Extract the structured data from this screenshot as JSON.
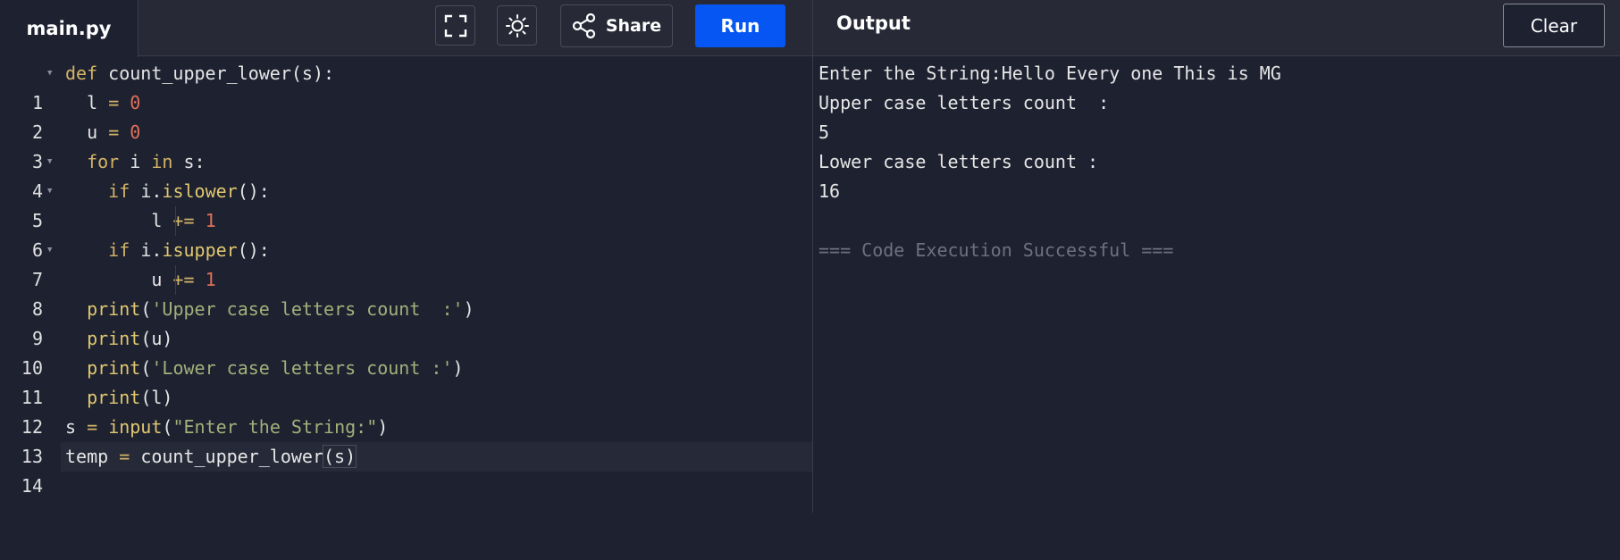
{
  "header": {
    "file_tab": "main.py",
    "share_label": "Share",
    "run_label": "Run",
    "output_title": "Output",
    "clear_label": "Clear"
  },
  "editor": {
    "lines": [
      {
        "num": "1"
      },
      {
        "num": "2"
      },
      {
        "num": "3"
      },
      {
        "num": "4"
      },
      {
        "num": "5"
      },
      {
        "num": "6"
      },
      {
        "num": "7"
      },
      {
        "num": "8"
      },
      {
        "num": "9"
      },
      {
        "num": "10"
      },
      {
        "num": "11"
      },
      {
        "num": "12"
      },
      {
        "num": "13"
      },
      {
        "num": "14"
      }
    ],
    "tokens": {
      "def": "def",
      "fn_name": "count_upper_lower",
      "param": "(s):",
      "l": "l",
      "u": "u",
      "eq": "=",
      "zero": "0",
      "for": "for",
      "i": "i",
      "in": "in",
      "s_colon": "s:",
      "if": "if",
      "i_dot": "i.",
      "islower": "islower",
      "isupper": "isupper",
      "call_colon": "():",
      "plus_eq": "+=",
      "one": "1",
      "print": "print",
      "str_upper": "'Upper case letters count  :'",
      "str_lower": "'Lower case letters count :'",
      "open_paren": "(",
      "close_paren": ")",
      "u_arg": "(u)",
      "l_arg": "(l)",
      "s": "s",
      "input": "input",
      "str_input": "\"Enter the String:\"",
      "temp": "temp",
      "call_fn": "count_upper_lower",
      "s_arg": "(s)"
    }
  },
  "output": {
    "lines": [
      "Enter the String:Hello Every one This is MG",
      "Upper case letters count  :",
      "5",
      "Lower case letters count :",
      "16",
      "",
      "=== Code Execution Successful ==="
    ]
  },
  "icons": [
    "fullscreen-icon",
    "theme-toggle-icon",
    "share-icon",
    "fold-arrow-icon"
  ]
}
